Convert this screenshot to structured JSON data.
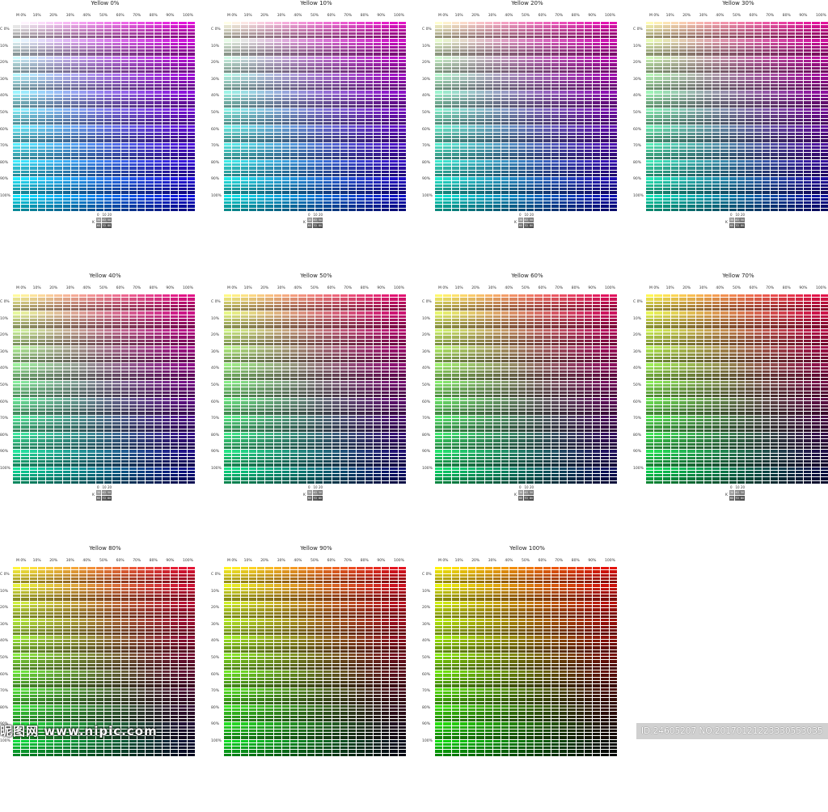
{
  "panels": [
    {
      "title": "Yellow 0%",
      "yellow": 0,
      "legend": true
    },
    {
      "title": "Yellow 10%",
      "yellow": 10,
      "legend": true
    },
    {
      "title": "Yellow 20%",
      "yellow": 20,
      "legend": true
    },
    {
      "title": "Yellow 30%",
      "yellow": 30,
      "legend": true
    },
    {
      "title": "Yellow 40%",
      "yellow": 40,
      "legend": true
    },
    {
      "title": "Yellow 50%",
      "yellow": 50,
      "legend": true
    },
    {
      "title": "Yellow 60%",
      "yellow": 60,
      "legend": true
    },
    {
      "title": "Yellow 70%",
      "yellow": 70,
      "legend": true
    },
    {
      "title": "Yellow 80%",
      "yellow": 80,
      "legend": false
    },
    {
      "title": "Yellow 90%",
      "yellow": 90,
      "legend": false
    },
    {
      "title": "Yellow 100%",
      "yellow": 100,
      "legend": false
    }
  ],
  "magenta_labels": [
    "M 0%",
    "10%",
    "20%",
    "30%",
    "40%",
    "50%",
    "60%",
    "70%",
    "80%",
    "90%",
    "100%"
  ],
  "cyan_labels": [
    "C 0%",
    "10%",
    "20%",
    "30%",
    "40%",
    "50%",
    "60%",
    "70%",
    "80%",
    "90%",
    "100%"
  ],
  "legend": {
    "k_label": "K",
    "numbers": [
      "0",
      "10",
      "20"
    ],
    "boxes": [
      "30",
      "40",
      "50",
      "60",
      "70",
      "80"
    ]
  },
  "watermark_left": "昵图网 www.nipic.com",
  "watermark_right": "ID:24605207 NO:20170121223330553035"
}
